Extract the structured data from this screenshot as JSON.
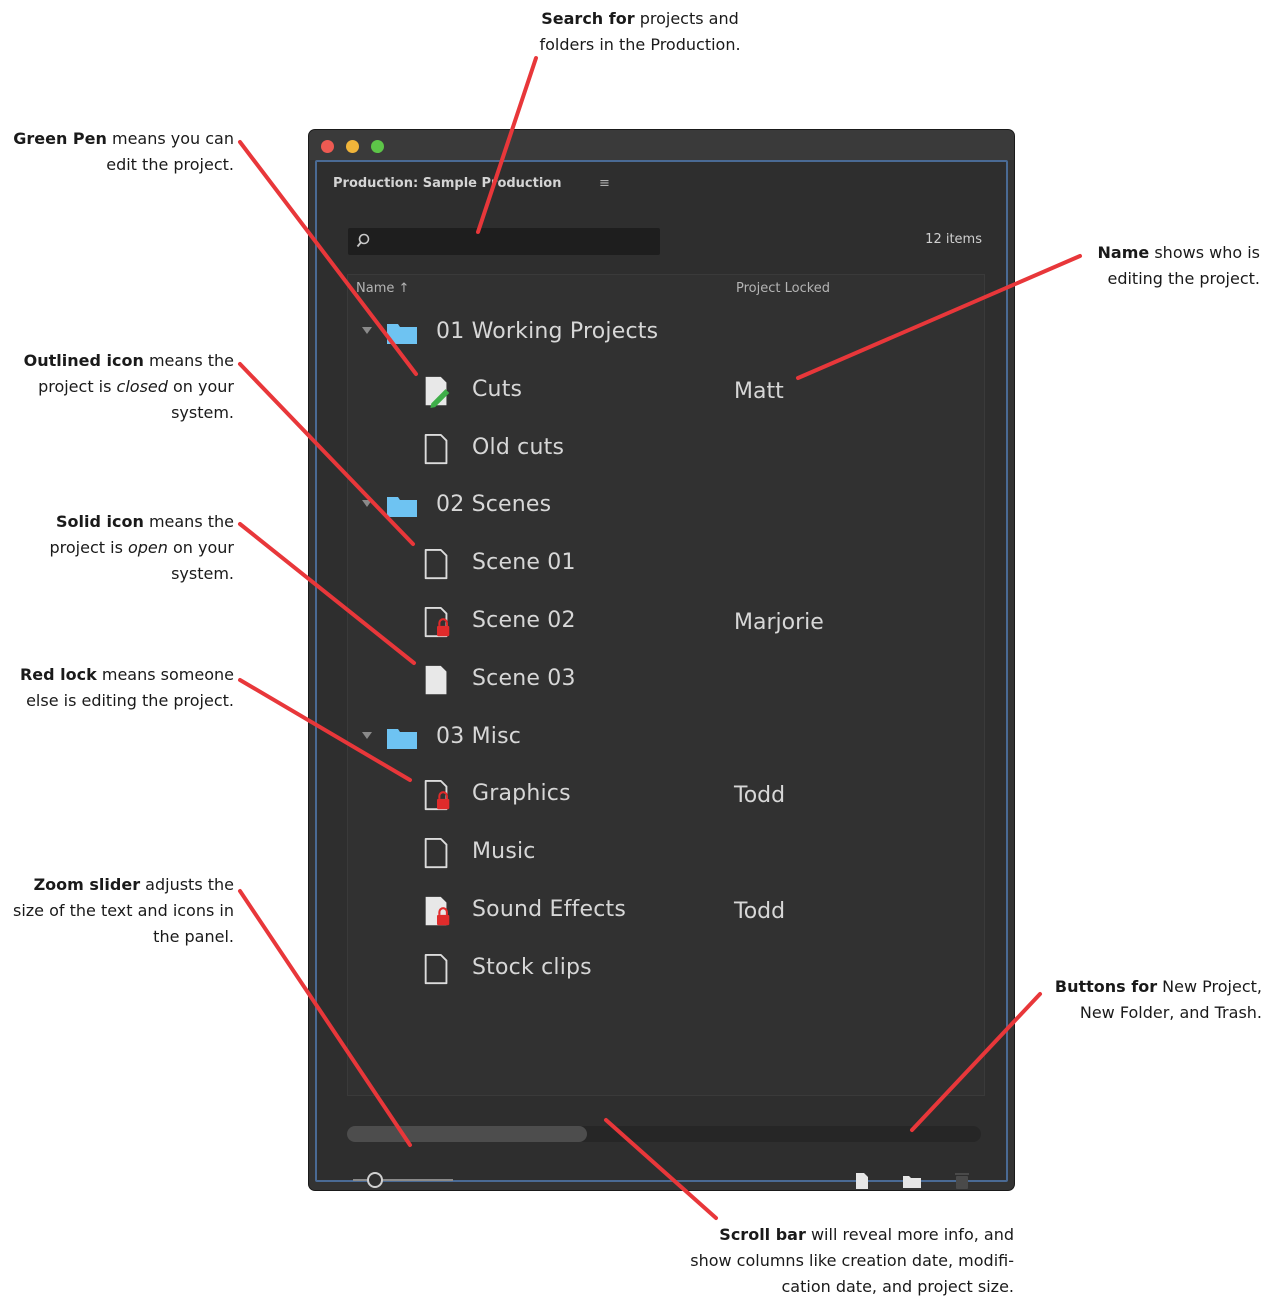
{
  "callouts": {
    "search": {
      "bold": "Search for",
      "rest1": " projects and",
      "line2": "folders in the Production."
    },
    "green_pen": {
      "bold": "Green Pen",
      "rest1": " means you can",
      "line2": "edit the project."
    },
    "name": {
      "bold": "Name",
      "rest1": " shows who is",
      "line2": "editing the project."
    },
    "outlined": {
      "bold": "Outlined icon",
      "rest1": " means the",
      "line2a": "project is ",
      "line2i": "closed",
      "line2b": " on your",
      "line3": "system."
    },
    "solid": {
      "bold": "Solid icon",
      "rest1": " means the",
      "line2a": "project is ",
      "line2i": "open",
      "line2b": " on your",
      "line3": "system."
    },
    "red_lock": {
      "bold": "Red lock",
      "rest1": " means someone",
      "line2": "else is editing the project."
    },
    "zoom": {
      "bold": "Zoom slider",
      "rest1": " adjusts the",
      "line2": "size of the text and icons in",
      "line3": "the panel."
    },
    "buttons": {
      "bold": "Buttons for",
      "rest1": " New Project,",
      "line2": "New Folder, and Trash."
    },
    "scroll": {
      "bold": "Scroll bar",
      "rest1": " will reveal more info, and",
      "line2": "show columns like creation date, modifi-",
      "line3": "cation date, and project size."
    }
  },
  "panel": {
    "title": "Production: Sample Production",
    "menu_icon": "≡",
    "item_count": "12 items",
    "columns": {
      "name": "Name ↑",
      "locked": "Project Locked"
    }
  },
  "rows": [
    {
      "type": "folder",
      "label": "01 Working Projects",
      "locked": ""
    },
    {
      "type": "file",
      "icon": "green-pen",
      "label": "Cuts",
      "locked": "Matt"
    },
    {
      "type": "file",
      "icon": "outlined",
      "label": "Old cuts",
      "locked": ""
    },
    {
      "type": "folder",
      "label": "02 Scenes",
      "locked": ""
    },
    {
      "type": "file",
      "icon": "outlined",
      "label": "Scene 01",
      "locked": ""
    },
    {
      "type": "file",
      "icon": "red-lock",
      "label": "Scene 02",
      "locked": "Marjorie"
    },
    {
      "type": "file",
      "icon": "solid",
      "label": "Scene 03",
      "locked": ""
    },
    {
      "type": "folder",
      "label": "03 Misc",
      "locked": ""
    },
    {
      "type": "file",
      "icon": "red-lock",
      "label": "Graphics",
      "locked": "Todd"
    },
    {
      "type": "file",
      "icon": "outlined",
      "label": "Music",
      "locked": ""
    },
    {
      "type": "file",
      "icon": "solid-red-lock",
      "label": "Sound Effects",
      "locked": "Todd"
    },
    {
      "type": "file",
      "icon": "outlined",
      "label": "Stock clips",
      "locked": ""
    }
  ],
  "colors": {
    "arrow": "#e8373a",
    "folder": "#6ec3f2",
    "pen": "#3fae49",
    "lock": "#e02b2b",
    "panel_border": "#4a6a94"
  }
}
